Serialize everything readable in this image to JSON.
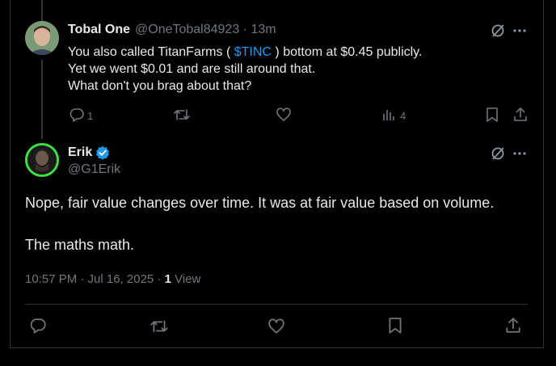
{
  "reply": {
    "name": "Tobal One",
    "handle": "@OneTobal84923",
    "separator": " · ",
    "time": "13m",
    "text_line1_before": "You also called TitanFarms ( ",
    "text_cashtag": "$TINC",
    "text_line1_after": " ) bottom  at $0.45 publicly.",
    "text_line2": "Yet we went $0.01 and are still around that.",
    "text_line3": "What don't you brag about that?",
    "reply_count": "1",
    "view_count": "4"
  },
  "main": {
    "name": "Erik",
    "handle": "@G1Erik",
    "paragraph1": "Nope, fair value changes over time. It was at fair value based on volume.",
    "paragraph2": "The maths math.",
    "timestamp": "10:57 PM · Jul 16, 2025 · ",
    "views_count": "1",
    "views_label": " View"
  },
  "colors": {
    "background": "#000000",
    "text": "#e7e9ea",
    "secondary": "#71767b",
    "link": "#1d9bf0",
    "verified": "#1d9bf0",
    "avatar_ring": "#39e23f"
  },
  "icons": [
    "grok-icon",
    "more-icon",
    "reply-icon",
    "retweet-icon",
    "like-icon",
    "views-icon",
    "bookmark-icon",
    "share-icon",
    "verified-badge-icon"
  ]
}
